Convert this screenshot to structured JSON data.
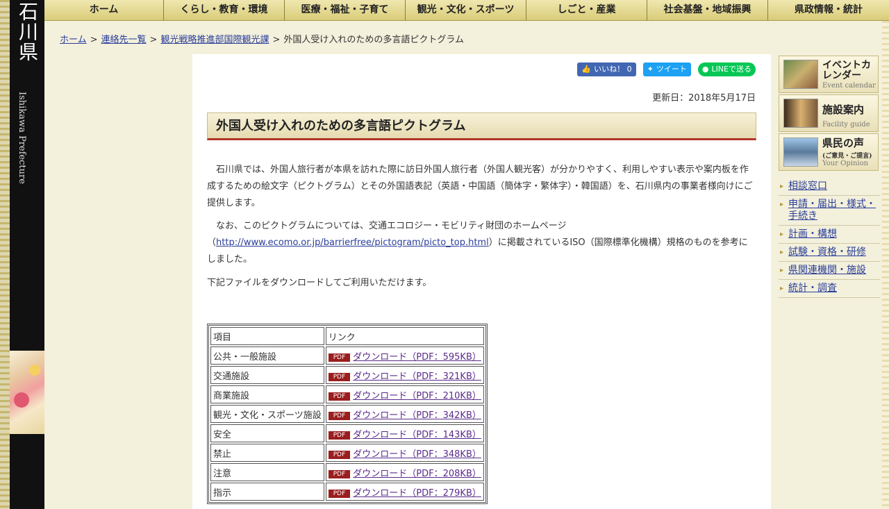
{
  "left": {
    "pref_kanji": "石川県",
    "pref_en": "Ishikawa Prefecture"
  },
  "nav": [
    "ホーム",
    "くらし・教育・環境",
    "医療・福祉・子育て",
    "観光・文化・スポーツ",
    "しごと・産業",
    "社会基盤・地域振興",
    "県政情報・統計"
  ],
  "breadcrumb": {
    "items": [
      "ホーム",
      "連絡先一覧",
      "観光戦略推進部国際観光課"
    ],
    "current": "外国人受け入れのための多言語ピクトグラム",
    "sep": ">"
  },
  "social": {
    "like": "いいね！ 0",
    "tweet": "ツイート",
    "line": "LINEで送る"
  },
  "updated": "更新日：2018年5月17日",
  "title": "外国人受け入れのための多言語ピクトグラム",
  "para1": "石川県では、外国人旅行者が本県を訪れた際に訪日外国人旅行者（外国人観光客）が分かりやすく、利用しやすい表示や案内板を作成するための絵文字（ピクトグラム）とその外国語表記（英語・中国語（簡体字・繁体字）・韓国語）を、石川県内の事業者様向けにご提供します。",
  "para2": {
    "before": "なお、このピクトグラムについては、交通エコロジー・モビリティ財団のホームページ（",
    "link": "http://www.ecomo.or.jp/barrierfree/pictogram/picto_top.html",
    "after": "）に掲載されているISO（国際標準化機構）規格のものを参考にしました。"
  },
  "para3": "下記ファイルをダウンロードしてご利用いただけます。",
  "table": {
    "headers": [
      "項目",
      "リンク"
    ],
    "pdf_label": "PDF",
    "rows": [
      {
        "item": "公共・一般施設",
        "link": "ダウンロード（PDF：595KB）"
      },
      {
        "item": "交通施設",
        "link": "ダウンロード（PDF：321KB）"
      },
      {
        "item": "商業施設",
        "link": "ダウンロード（PDF：210KB）"
      },
      {
        "item": "観光・文化・スポーツ施設",
        "link": "ダウンロード（PDF：342KB）"
      },
      {
        "item": "安全",
        "link": "ダウンロード（PDF：143KB）"
      },
      {
        "item": "禁止",
        "link": "ダウンロード（PDF：348KB）"
      },
      {
        "item": "注意",
        "link": "ダウンロード（PDF：208KB）"
      },
      {
        "item": "指示",
        "link": "ダウンロード（PDF：279KB）"
      }
    ]
  },
  "banners": [
    {
      "title": "イベントカレンダー",
      "sub": "Event calendar"
    },
    {
      "title": "施設案内",
      "sub": "Facility guide"
    },
    {
      "title": "県民の声",
      "sub": "Your Opinion",
      "note": "(ご意見・ご提言)"
    }
  ],
  "side_links": [
    "相談窓口",
    "申請・届出・様式・手続き",
    "計画・構想",
    "試験・資格・研修",
    "県関連機関・施設",
    "統計・調査"
  ]
}
